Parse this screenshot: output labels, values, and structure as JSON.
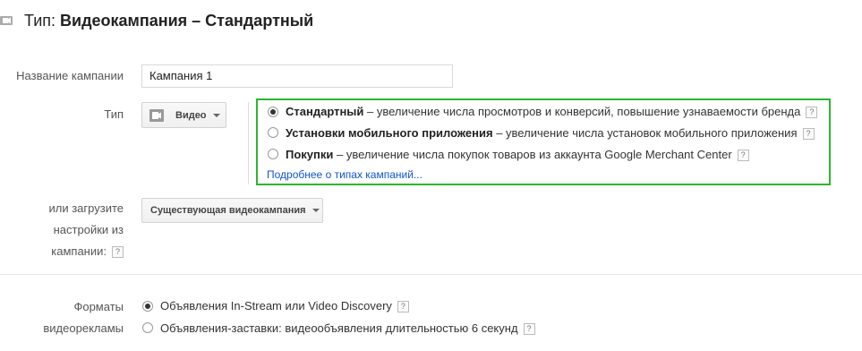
{
  "header": {
    "prefix": "Тип: ",
    "title": "Видеокампания – Стандартный",
    "icon": "video-camera-icon"
  },
  "campaign_name": {
    "label": "Название кампании",
    "value": "Кампания 1"
  },
  "type": {
    "label": "Тип",
    "dropdown_label": "Видео",
    "options": [
      {
        "title": "Стандартный",
        "desc": " – увеличение числа просмотров и конверсий, повышение узнаваемости бренда",
        "selected": true
      },
      {
        "title": "Установки мобильного приложения",
        "desc": " – увеличение числа установок мобильного приложения",
        "selected": false
      },
      {
        "title": "Покупки",
        "desc": " – увеличение числа покупок товаров из аккаунта Google Merchant Center",
        "selected": false
      }
    ],
    "more_link": "Подробнее о типах кампаний..."
  },
  "load_settings": {
    "label_line1": "или загрузите",
    "label_line2": "настройки из",
    "label_line3": "кампании:",
    "dropdown_label": "Существующая видеокампания"
  },
  "formats": {
    "label_line1": "Форматы",
    "label_line2": "видеорекламы",
    "options": [
      {
        "label": "Объявления In-Stream или Video Discovery",
        "selected": true
      },
      {
        "label": "Объявления-заставки: видеообъявления длительностью 6 секунд",
        "selected": false
      }
    ]
  },
  "help_mark": "?",
  "colors": {
    "highlight_border": "#2db52d",
    "link": "#1155cc"
  }
}
